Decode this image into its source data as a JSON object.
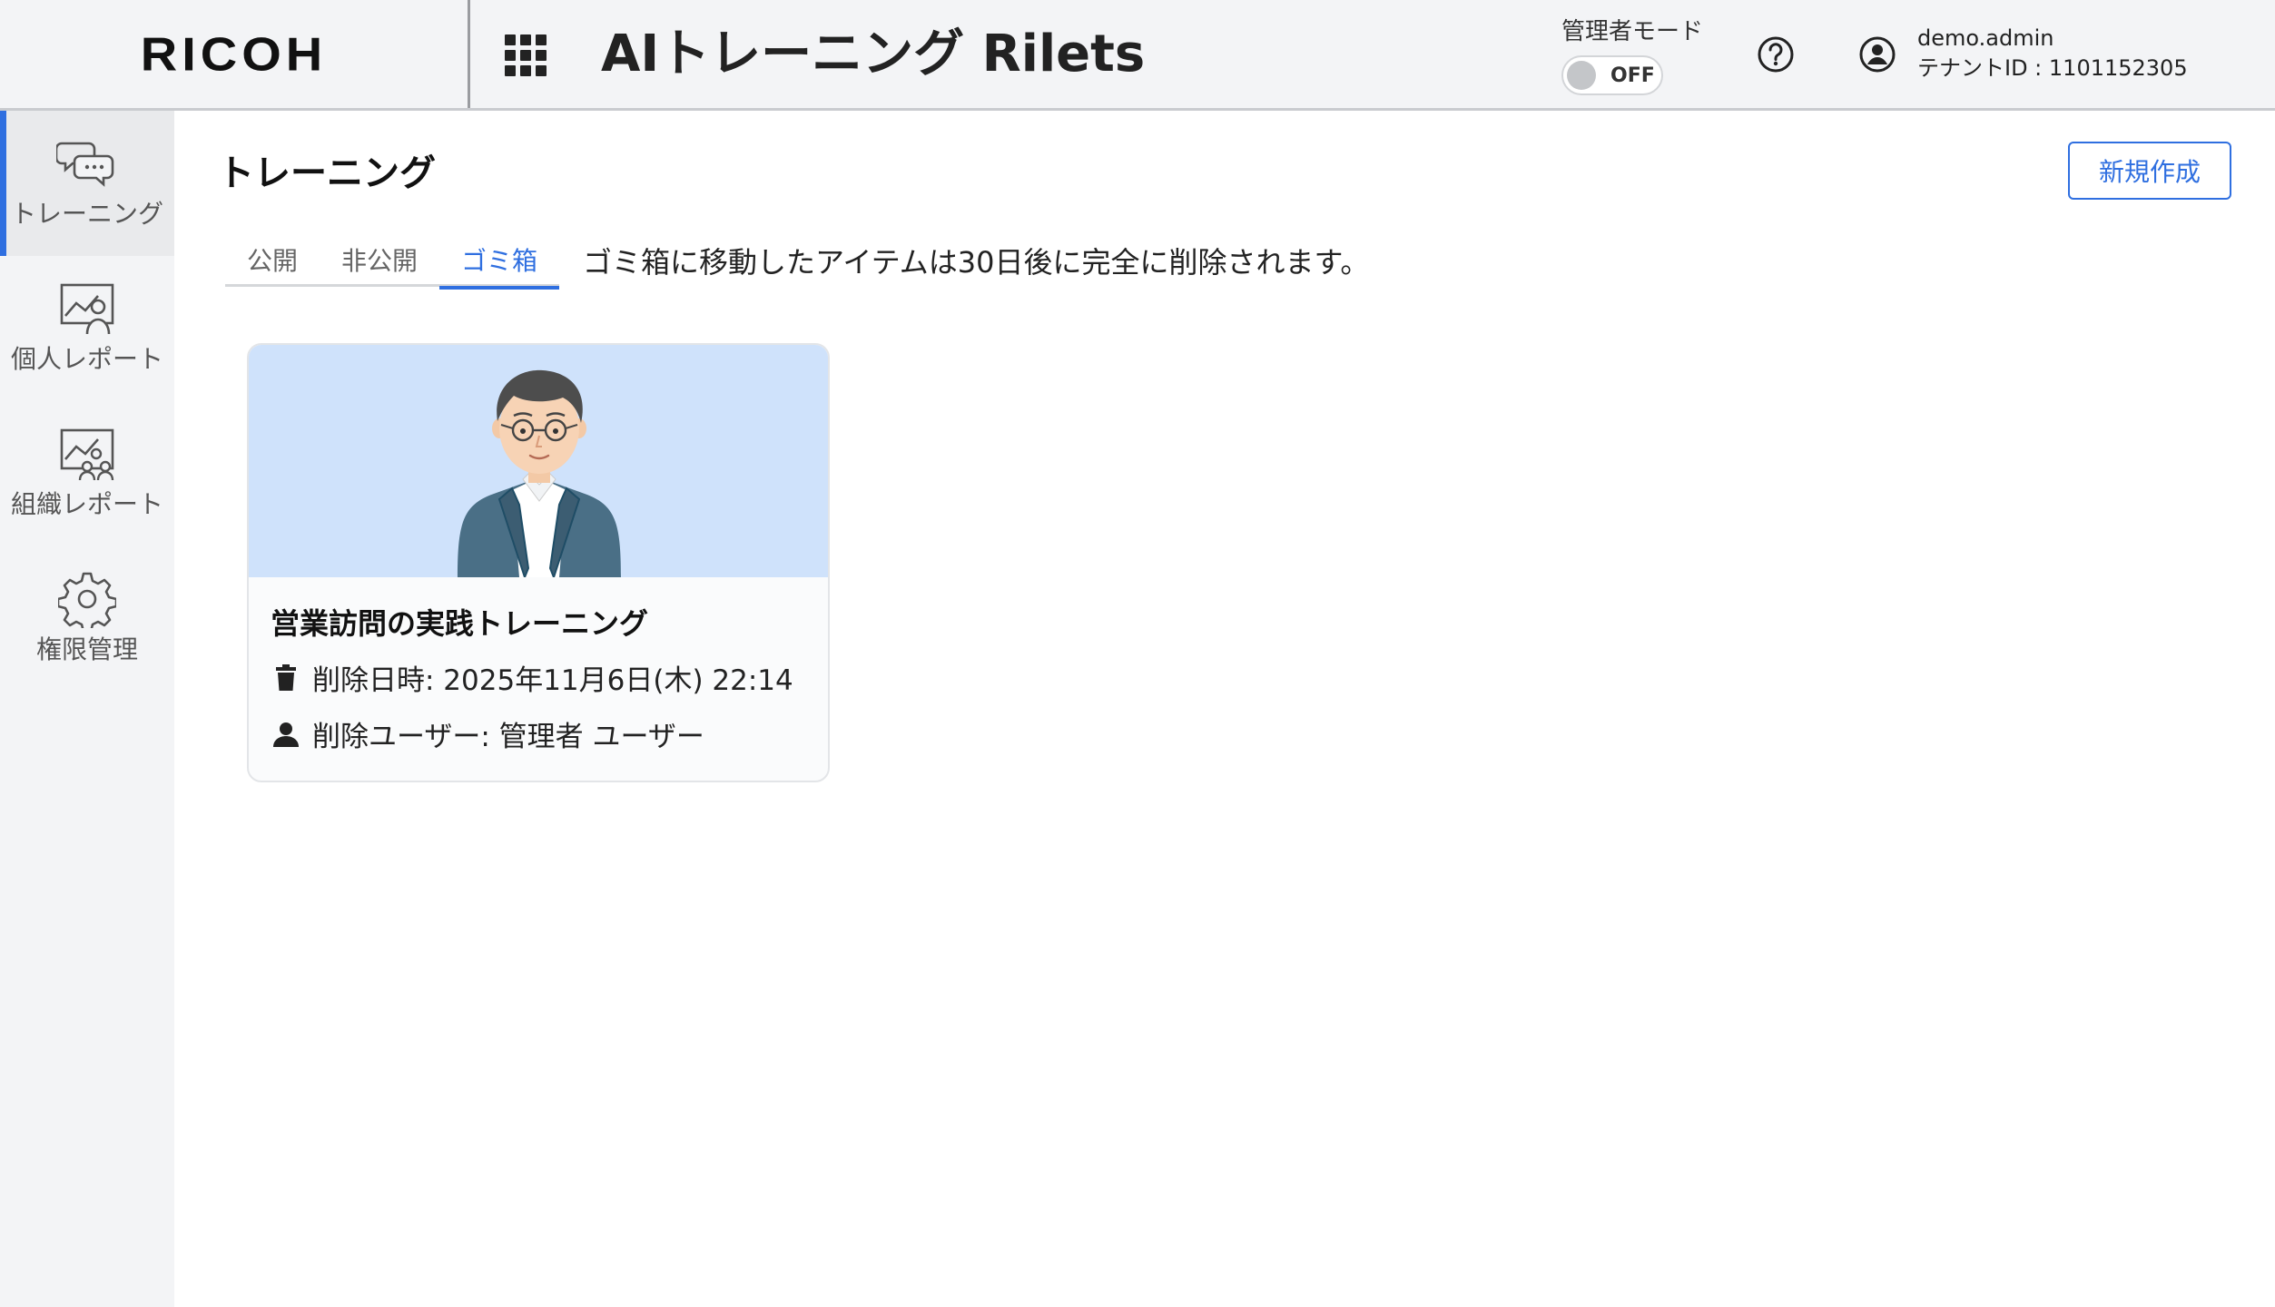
{
  "header": {
    "logo": "RICOH",
    "app_title": "AIトレーニング Rilets",
    "admin_mode_label": "管理者モード",
    "admin_mode_toggle": "OFF",
    "username": "demo.admin",
    "tenant_id": "テナントID : 1101152305",
    "icons": {
      "apps": "apps-grid-icon",
      "help": "help-circle-icon",
      "user": "user-circle-icon"
    }
  },
  "sidebar": {
    "items": [
      {
        "label": "トレーニング",
        "icon": "chat-bubbles-icon",
        "active": true
      },
      {
        "label": "個人レポート",
        "icon": "personal-report-icon",
        "active": false
      },
      {
        "label": "組織レポート",
        "icon": "organization-report-icon",
        "active": false
      },
      {
        "label": "権限管理",
        "icon": "gear-icon",
        "active": false
      }
    ]
  },
  "main": {
    "page_title": "トレーニング",
    "new_button_label": "新規作成",
    "tabs": [
      {
        "label": "公開",
        "active": false
      },
      {
        "label": "非公開",
        "active": false
      },
      {
        "label": "ゴミ箱",
        "active": true
      }
    ],
    "trash_notice": "ゴミ箱に移動したアイテムは30日後に完全に削除されます。",
    "cards": [
      {
        "title": "営業訪問の実践トレーニング",
        "deleted_at": "削除日時: 2025年11月6日(木) 22:14",
        "deleted_by": "削除ユーザー: 管理者 ユーザー",
        "image": "businessman-avatar"
      }
    ]
  },
  "colors": {
    "accent": "#2f6fe0",
    "header_bg": "#f3f4f6",
    "sidebar_bg": "#f3f4f6",
    "card_image_bg": "#cfe2fb"
  }
}
